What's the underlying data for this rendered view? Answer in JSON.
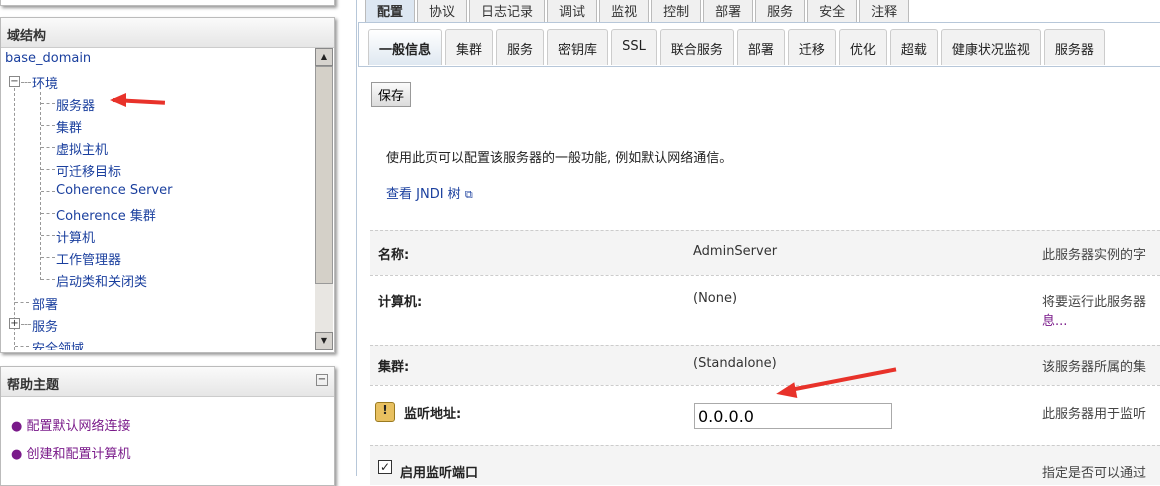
{
  "domain_panel": {
    "title": "域结构",
    "root": "base_domain",
    "items": [
      {
        "label": "环境",
        "expand": "minus"
      },
      {
        "label": "服务器"
      },
      {
        "label": "集群"
      },
      {
        "label": "虚拟主机"
      },
      {
        "label": "可迁移目标"
      },
      {
        "label": "Coherence Server"
      },
      {
        "label": "Coherence 集群"
      },
      {
        "label": "计算机"
      },
      {
        "label": "工作管理器"
      },
      {
        "label": "启动类和关闭类"
      },
      {
        "label": "部署"
      },
      {
        "label": "服务",
        "expand": "plus"
      },
      {
        "label": "安全领域"
      }
    ]
  },
  "help_panel": {
    "title": "帮助主题",
    "links": [
      "配置默认网络连接",
      "创建和配置计算机"
    ]
  },
  "tabs": [
    "配置",
    "协议",
    "日志记录",
    "调试",
    "监视",
    "控制",
    "部署",
    "服务",
    "安全",
    "注释"
  ],
  "subtabs": [
    "一般信息",
    "集群",
    "服务",
    "密钥库",
    "SSL",
    "联合服务",
    "部署",
    "迁移",
    "优化",
    "超载",
    "健康状况监视",
    "服务器"
  ],
  "save_label": "保存",
  "intro": "使用此页可以配置该服务器的一般功能, 例如默认网络通信。",
  "jndi_link": "查看 JNDI 树",
  "fields": [
    {
      "label": "名称:",
      "value": "AdminServer",
      "desc": "此服务器实例的字"
    },
    {
      "label": "计算机:",
      "value": "(None)",
      "desc": "将要运行此服务器",
      "more": "息..."
    },
    {
      "label": "集群:",
      "value": "(Standalone)",
      "desc": "该服务器所属的集"
    },
    {
      "label": "监听地址:",
      "value": "0.0.0.0",
      "desc": "此服务器用于监听"
    },
    {
      "label": "启用监听端口",
      "desc": "指定是否可以通过",
      "checked": true
    }
  ],
  "colors": {
    "link": "#1a3f9e",
    "visited": "#7a1a8a",
    "arrow": "#e8322a"
  }
}
